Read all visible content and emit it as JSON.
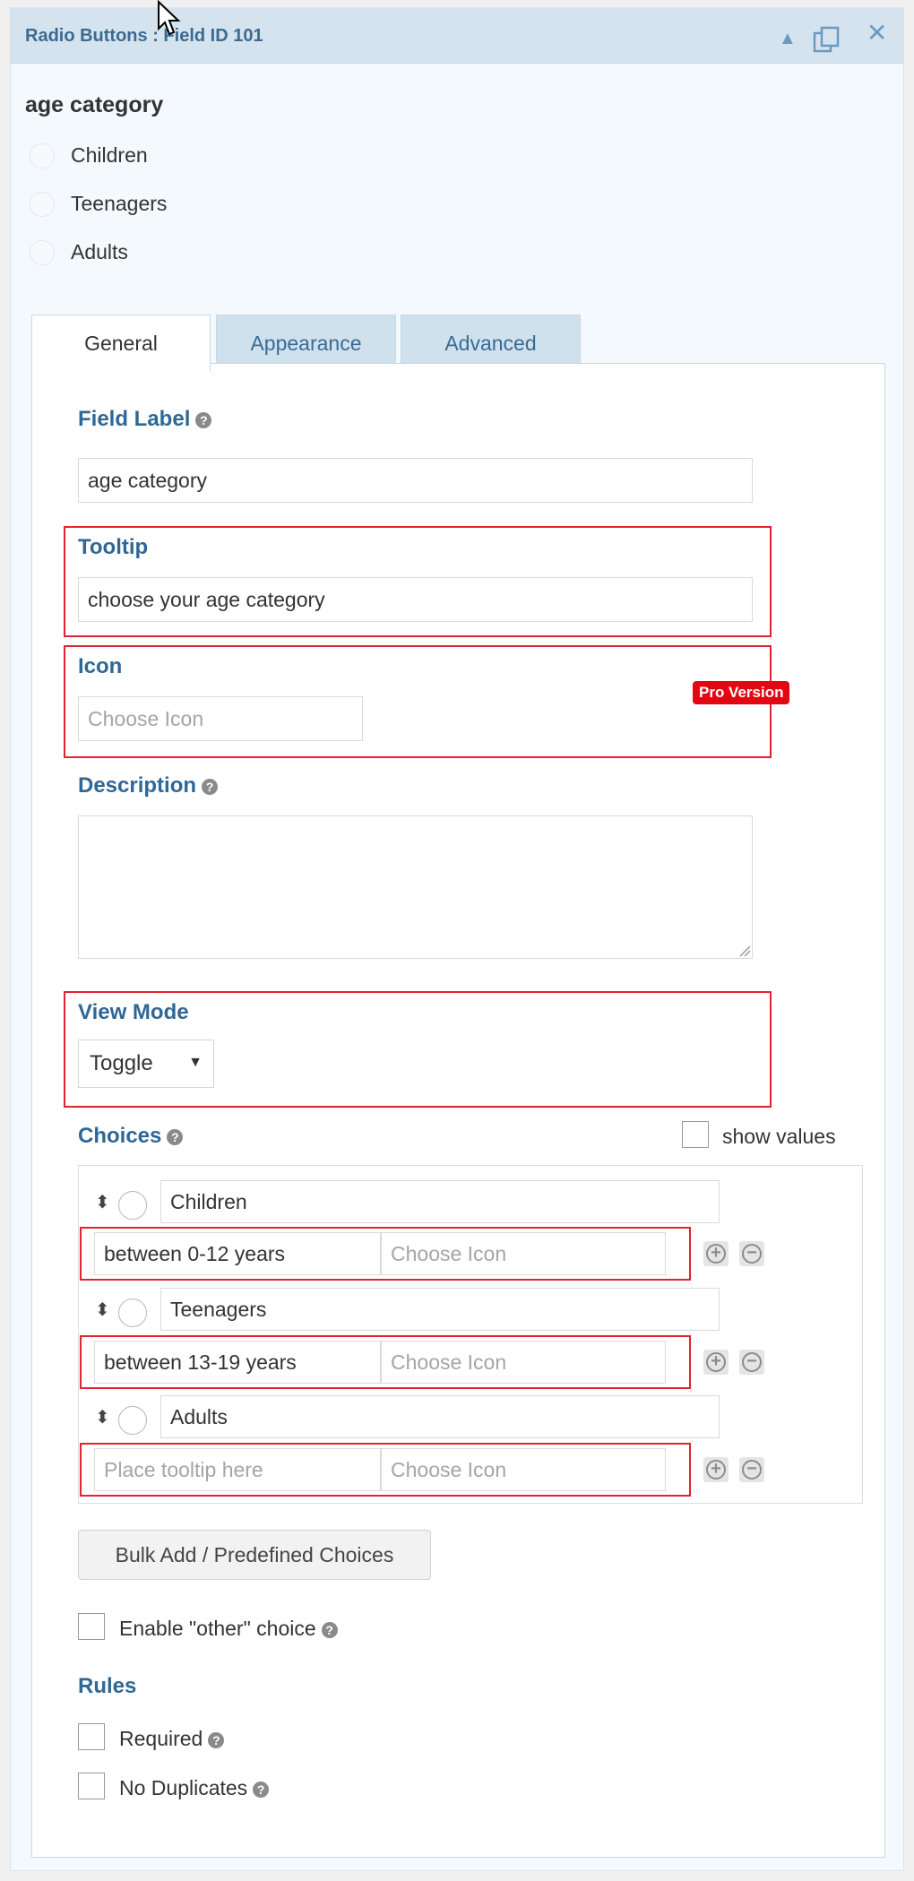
{
  "header": {
    "title": "Radio Buttons : Field ID 101",
    "icons": [
      "collapse-arrow-icon",
      "duplicate-icon",
      "close-icon"
    ]
  },
  "preview": {
    "label": "age category",
    "choices": [
      "Children",
      "Teenagers",
      "Adults"
    ]
  },
  "tabs": [
    {
      "label": "General",
      "active": true
    },
    {
      "label": "Appearance",
      "active": false
    },
    {
      "label": "Advanced",
      "active": false
    }
  ],
  "general": {
    "field_label": {
      "label": "Field Label",
      "value": "age category"
    },
    "tooltip": {
      "label": "Tooltip",
      "value": "choose your age category"
    },
    "icon": {
      "label": "Icon",
      "placeholder": "Choose Icon",
      "badge": "Pro Version"
    },
    "description": {
      "label": "Description",
      "value": ""
    },
    "view_mode": {
      "label": "View Mode",
      "selected": "Toggle"
    },
    "choices": {
      "label": "Choices",
      "show_values_label": "show values",
      "items": [
        {
          "label": "Children",
          "tooltip": "between 0-12 years",
          "icon_placeholder": "Choose Icon"
        },
        {
          "label": "Teenagers",
          "tooltip": "between 13-19 years",
          "icon_placeholder": "Choose Icon"
        },
        {
          "label": "Adults",
          "tooltip": "",
          "tooltip_placeholder": "Place tooltip here",
          "icon_placeholder": "Choose Icon"
        }
      ]
    },
    "bulk_add_label": "Bulk Add / Predefined Choices",
    "enable_other_label": "Enable \"other\" choice",
    "rules": {
      "label": "Rules",
      "required_label": "Required",
      "no_duplicates_label": "No Duplicates"
    }
  },
  "colors": {
    "accent": "#2f6796",
    "header_bg": "#d5e3ee",
    "highlight_border": "#e0242f",
    "pro_badge": "#e40613"
  }
}
